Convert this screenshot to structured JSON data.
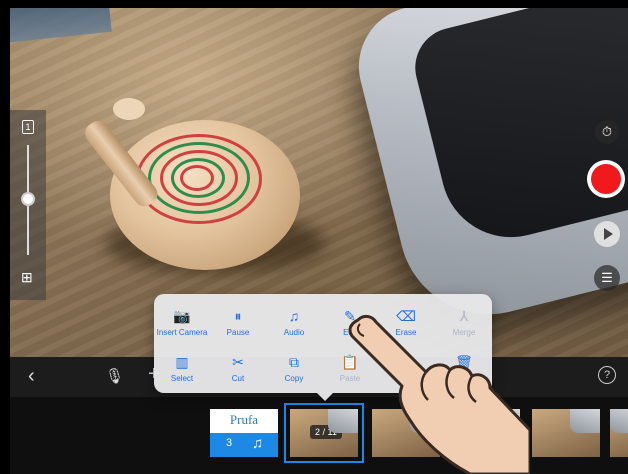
{
  "preview": {
    "label": "camera-preview"
  },
  "toolbar": {
    "back": "‹",
    "mic": "🎙",
    "plus": "+",
    "help": "?"
  },
  "timeline": {
    "title_clip": {
      "text": "Prufa",
      "number": "3",
      "icon": "music-note-icon"
    },
    "selected_clip_badge": "2 / 11"
  },
  "menu": {
    "row1": [
      {
        "label": "Insert Camera",
        "icon": "camera-icon",
        "glyph": "📷",
        "enabled": true
      },
      {
        "label": "Pause",
        "icon": "pause-icon",
        "glyph": "⏸",
        "enabled": true
      },
      {
        "label": "Audio",
        "icon": "music-note-icon",
        "glyph": "♫",
        "enabled": true
      },
      {
        "label": "Edit",
        "icon": "pencil-icon",
        "glyph": "✎",
        "enabled": true
      },
      {
        "label": "Erase",
        "icon": "eraser-icon",
        "glyph": "⌫",
        "enabled": true
      },
      {
        "label": "Merge",
        "icon": "merge-icon",
        "glyph": "⅄",
        "enabled": false
      }
    ],
    "row2": [
      {
        "label": "Select",
        "icon": "select-icon",
        "glyph": "▥",
        "enabled": true
      },
      {
        "label": "Cut",
        "icon": "scissors-icon",
        "glyph": "✂",
        "enabled": true
      },
      {
        "label": "Copy",
        "icon": "copy-icon",
        "glyph": "⧉",
        "enabled": true
      },
      {
        "label": "Paste",
        "icon": "paste-icon",
        "glyph": "📋",
        "enabled": false
      },
      {
        "label": "",
        "icon": "hidden-icon",
        "glyph": "",
        "enabled": true
      },
      {
        "label": "",
        "icon": "trash-icon",
        "glyph": "🗑",
        "enabled": true
      }
    ]
  },
  "colors": {
    "accent": "#1e6fe0",
    "record": "#f2191c",
    "menu_bg": "#e8e8ea"
  }
}
